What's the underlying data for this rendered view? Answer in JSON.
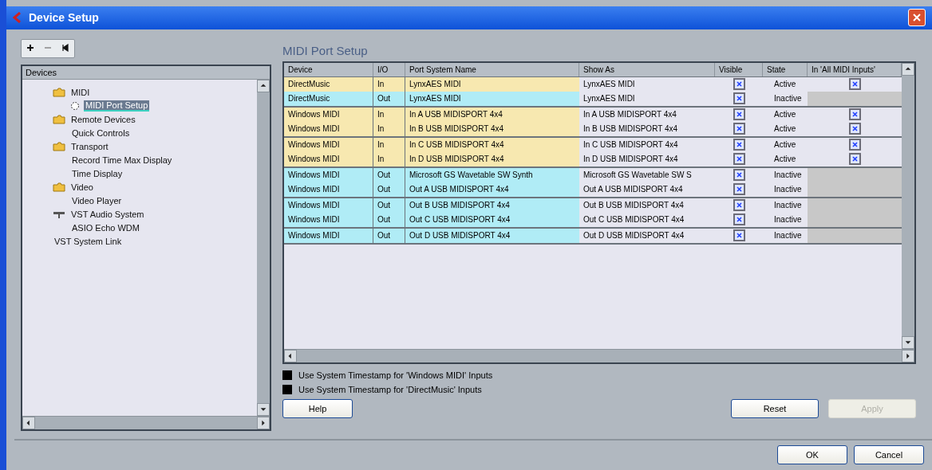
{
  "window": {
    "title": "Device Setup"
  },
  "toolbar": [
    {
      "kind": "add"
    },
    {
      "kind": "remove"
    },
    {
      "kind": "reset"
    }
  ],
  "tree": {
    "heading": "Devices",
    "items": [
      {
        "label": "MIDI",
        "kind": "folder",
        "selected": false,
        "children": [
          {
            "label": "MIDI Port Setup",
            "kind": "device",
            "selected": true
          }
        ]
      },
      {
        "label": "Remote Devices",
        "kind": "folder",
        "selected": false,
        "children": [
          {
            "label": "Quick Controls",
            "selected": false
          }
        ]
      },
      {
        "label": "Transport",
        "kind": "folder",
        "selected": false,
        "children": [
          {
            "label": "Record Time Max Display",
            "selected": false
          },
          {
            "label": "Time Display",
            "selected": false
          }
        ]
      },
      {
        "label": "Video",
        "kind": "folder",
        "selected": false,
        "children": [
          {
            "label": "Video Player",
            "selected": false
          }
        ]
      },
      {
        "label": "VST Audio System",
        "kind": "audio",
        "selected": false,
        "children": [
          {
            "label": "ASIO Echo WDM",
            "selected": false
          }
        ]
      },
      {
        "label": "VST System Link",
        "selected": false
      }
    ]
  },
  "panel_title": "MIDI Port Setup",
  "table": {
    "columns": [
      "Device",
      "I/O",
      "Port System Name",
      "Show As",
      "Visible",
      "State",
      "In 'All MIDI Inputs'"
    ],
    "groups": [
      {
        "rows": [
          {
            "kind": "in",
            "device": "DirectMusic",
            "io": "In",
            "port": "LynxAES MIDI",
            "show_as": "LynxAES MIDI",
            "visible": true,
            "state": "Active",
            "all_inputs": true
          },
          {
            "kind": "out",
            "device": "DirectMusic",
            "io": "Out",
            "port": "LynxAES MIDI",
            "show_as": "LynxAES MIDI",
            "visible": true,
            "state": "Inactive"
          }
        ]
      },
      {
        "rows": [
          {
            "kind": "in",
            "device": "Windows MIDI",
            "io": "In",
            "port": "In A USB MIDISPORT 4x4",
            "show_as": "In A USB MIDISPORT 4x4",
            "visible": true,
            "state": "Active",
            "all_inputs": true
          },
          {
            "kind": "in",
            "device": "Windows MIDI",
            "io": "In",
            "port": "In B USB MIDISPORT 4x4",
            "show_as": "In B USB MIDISPORT 4x4",
            "visible": true,
            "state": "Active",
            "all_inputs": true
          }
        ]
      },
      {
        "rows": [
          {
            "kind": "in",
            "device": "Windows MIDI",
            "io": "In",
            "port": "In C USB MIDISPORT 4x4",
            "show_as": "In C USB MIDISPORT 4x4",
            "visible": true,
            "state": "Active",
            "all_inputs": true
          },
          {
            "kind": "in",
            "device": "Windows MIDI",
            "io": "In",
            "port": "In D USB MIDISPORT 4x4",
            "show_as": "In D USB MIDISPORT 4x4",
            "visible": true,
            "state": "Active",
            "all_inputs": true
          }
        ]
      },
      {
        "rows": [
          {
            "kind": "out",
            "device": "Windows MIDI",
            "io": "Out",
            "port": "Microsoft GS Wavetable SW Synth",
            "show_as": "Microsoft GS Wavetable SW S",
            "visible": true,
            "state": "Inactive"
          },
          {
            "kind": "out",
            "device": "Windows MIDI",
            "io": "Out",
            "port": "Out A USB MIDISPORT 4x4",
            "show_as": "Out A USB MIDISPORT 4x4",
            "visible": true,
            "state": "Inactive"
          }
        ]
      },
      {
        "rows": [
          {
            "kind": "out",
            "device": "Windows MIDI",
            "io": "Out",
            "port": "Out B USB MIDISPORT 4x4",
            "show_as": "Out B USB MIDISPORT 4x4",
            "visible": true,
            "state": "Inactive"
          },
          {
            "kind": "out",
            "device": "Windows MIDI",
            "io": "Out",
            "port": "Out C USB MIDISPORT 4x4",
            "show_as": "Out C USB MIDISPORT 4x4",
            "visible": true,
            "state": "Inactive"
          }
        ]
      },
      {
        "rows": [
          {
            "kind": "out",
            "device": "Windows MIDI",
            "io": "Out",
            "port": "Out D USB MIDISPORT 4x4",
            "show_as": "Out D USB MIDISPORT 4x4",
            "visible": true,
            "state": "Inactive"
          }
        ]
      }
    ]
  },
  "options": [
    {
      "label": "Use System Timestamp for 'Windows MIDI' Inputs",
      "checked": false
    },
    {
      "label": "Use System Timestamp for 'DirectMusic' Inputs",
      "checked": false
    }
  ],
  "buttons": {
    "help": {
      "label": "Help",
      "disabled": false
    },
    "reset": {
      "label": "Reset",
      "disabled": false
    },
    "apply": {
      "label": "Apply",
      "disabled": true
    },
    "ok": {
      "label": "OK",
      "disabled": false
    },
    "cancel": {
      "label": "Cancel",
      "disabled": false
    }
  }
}
